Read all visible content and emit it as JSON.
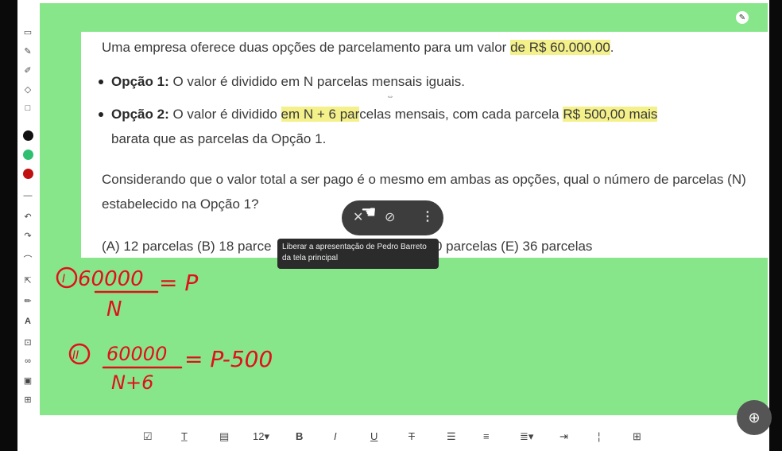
{
  "problem": {
    "intro_prefix": "Uma empresa oferece duas opções de parcelamento para um valor ",
    "intro_highlight": "de R$ 60.000,00",
    "intro_suffix": ".",
    "option1_label": "Opção 1:",
    "option1_text": " O valor é dividido em N parcelas mensais iguais.",
    "option2_label": "Opção 2:",
    "option2_pre": " O valor é dividido ",
    "option2_hl1": "em N + 6 par",
    "option2_mid": "celas mensais, com cada parcela ",
    "option2_hl2": "R$ 500,00 mais",
    "option2_line2": "barata que as parcelas da Opção 1.",
    "question": "Considerando que o valor total a ser pago é o mesmo em ambas as opções, qual o número de parcelas (N) estabelecido na Opção 1?",
    "answers_left": "(A) 12 parcelas (B) 18 parce",
    "answers_right": "30 parcelas (E) 36 parcelas"
  },
  "tooltip": {
    "text": "Liberar a apresentação de Pedro Barreto da tela principal"
  },
  "handwriting": {
    "eq1_label": "I",
    "eq1_numerator": "60000",
    "eq1_denominator": "N",
    "eq1_rhs": "= P",
    "eq2_label": "II",
    "eq2_numerator": "60000",
    "eq2_denominator": "N+6",
    "eq2_rhs": "= P-500"
  },
  "bottom_toolbar": {
    "font_size": "12",
    "bold": "B",
    "italic": "I",
    "underline": "U",
    "strike": "T"
  },
  "colors": {
    "board": "#88e68a",
    "ink": "#e0101a",
    "highlight": "#f4f08a"
  },
  "icons": [
    "pen-icon",
    "eraser-icon",
    "undo-icon",
    "zoom-icon",
    "more-vertical-icon",
    "unpin-icon",
    "mute-icon"
  ]
}
